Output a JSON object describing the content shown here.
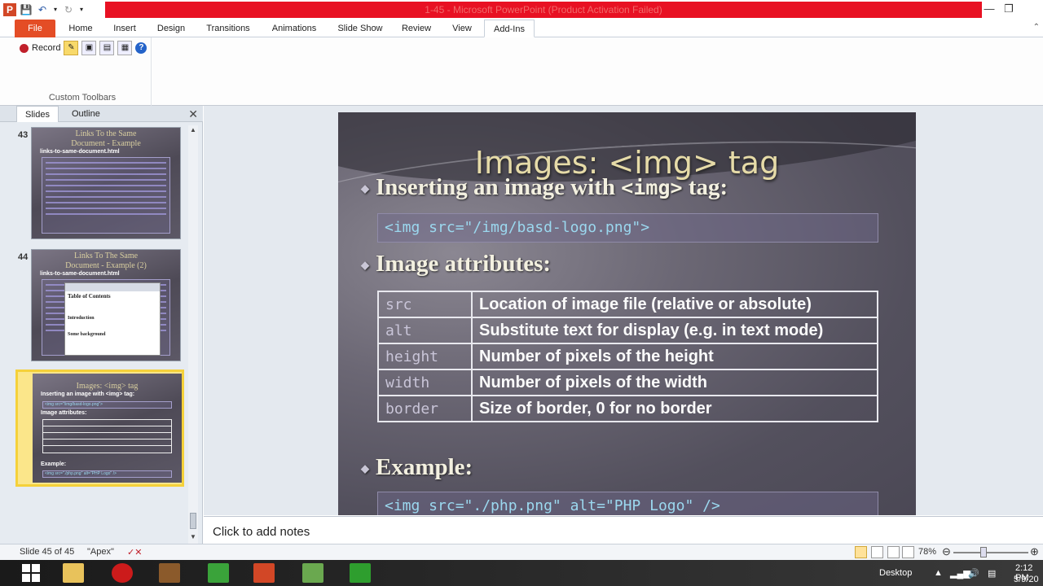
{
  "window": {
    "title": "1-45 - Microsoft PowerPoint (Product Activation Failed)",
    "app_icon": "P"
  },
  "ribbon_tabs": [
    "File",
    "Home",
    "Insert",
    "Design",
    "Transitions",
    "Animations",
    "Slide Show",
    "Review",
    "View",
    "Add-Ins"
  ],
  "active_tab": "Add-Ins",
  "ribbon": {
    "record_label": "Record",
    "group_label": "Custom Toolbars"
  },
  "slide_pane": {
    "tabs": [
      "Slides",
      "Outline"
    ],
    "thumbs": [
      {
        "num": "43",
        "title_line1": "Links To the Same",
        "title_line2": "Document - Example",
        "filename": "links-to-same-document.html"
      },
      {
        "num": "44",
        "title_line1": "Links To The Same",
        "title_line2": "Document - Example (2)",
        "filename": "links-to-same-document.html",
        "toc": "Table of Contents",
        "intro": "Introduction",
        "bg": "Some background"
      },
      {
        "num": "45",
        "title_line1": "Images: <img> tag",
        "line2": "Inserting an image with <img> tag:",
        "code1": "<img src=\"/img/basd-logo.png\">",
        "attrs": "Image attributes:",
        "example": "Example:",
        "code2": "<img src=\"./php.png\" alt=\"PHP Logo\" />"
      }
    ]
  },
  "slide": {
    "title": "Images: <img> tag",
    "bullet1_prefix": "Inserting an image with ",
    "bullet1_code": "<img>",
    "bullet1_suffix": " tag:",
    "code1": "<img src=\"/img/basd-logo.png\">",
    "bullet2": "Image attributes:",
    "attributes": [
      {
        "name": "src",
        "desc": "Location of image file (relative or absolute)"
      },
      {
        "name": "alt",
        "desc": "Substitute text for display (e.g. in text mode)"
      },
      {
        "name": "height",
        "desc": "Number of pixels of the height"
      },
      {
        "name": "width",
        "desc": "Number of pixels of the width"
      },
      {
        "name": "border",
        "desc": "Size of border, 0 for no border"
      }
    ],
    "bullet3": "Example:",
    "code2": "<img src=\"./php.png\" alt=\"PHP Logo\" />"
  },
  "notes_placeholder": "Click to add notes",
  "status": {
    "slide_counter": "Slide 45 of 45",
    "theme": "\"Apex\"",
    "zoom": "78%"
  },
  "taskbar": {
    "desktop_label": "Desktop",
    "time": "2:12 PM",
    "date": "5/9/20"
  }
}
